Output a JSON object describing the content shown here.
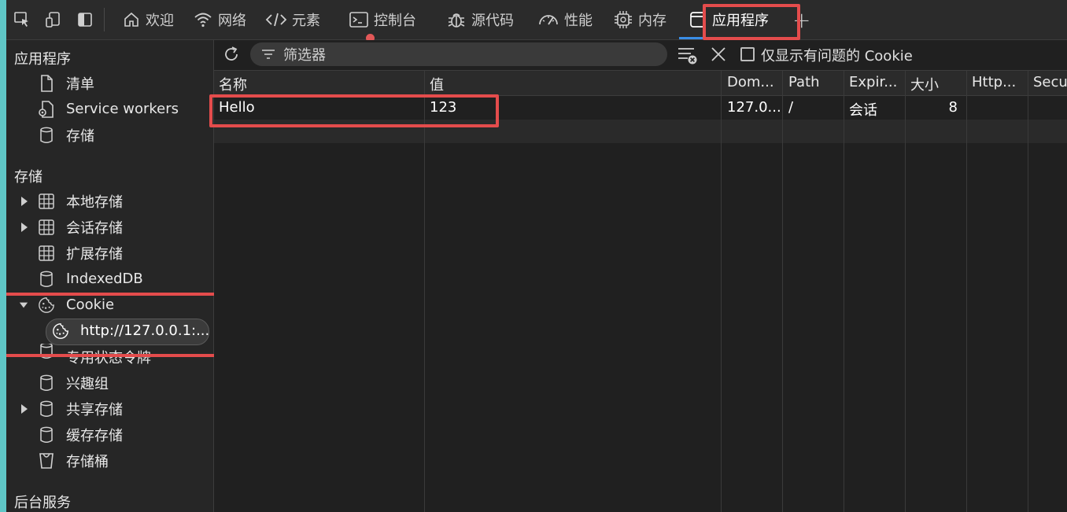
{
  "topbar": {
    "tabs": [
      {
        "label": "欢迎",
        "icon": "home-icon"
      },
      {
        "label": "网络",
        "icon": "wifi-icon"
      },
      {
        "label": "元素",
        "icon": "code-icon"
      },
      {
        "label": "控制台",
        "icon": "console-icon"
      },
      {
        "label": "源代码",
        "icon": "bug-icon"
      },
      {
        "label": "性能",
        "icon": "gauge-icon"
      },
      {
        "label": "内存",
        "icon": "chip-icon"
      },
      {
        "label": "应用程序",
        "icon": "window-icon"
      }
    ],
    "add_tab": "+"
  },
  "sidebar": {
    "section1": {
      "title": "应用程序",
      "items": [
        {
          "label": "清单",
          "icon": "document-icon"
        },
        {
          "label": "Service workers",
          "icon": "service-worker-icon"
        },
        {
          "label": "存储",
          "icon": "database-icon"
        }
      ]
    },
    "section2": {
      "title": "存储",
      "items": [
        {
          "label": "本地存储",
          "icon": "grid-icon"
        },
        {
          "label": "会话存储",
          "icon": "grid-icon"
        },
        {
          "label": "扩展存储",
          "icon": "grid-icon"
        },
        {
          "label": "IndexedDB",
          "icon": "database-icon"
        },
        {
          "label": "Cookie",
          "icon": "cookie-icon"
        },
        {
          "label": "http://127.0.0.1:...",
          "icon": "cookie-icon"
        },
        {
          "label": "专用状态令牌",
          "icon": "database-icon"
        },
        {
          "label": "兴趣组",
          "icon": "database-icon"
        },
        {
          "label": "共享存储",
          "icon": "database-icon"
        },
        {
          "label": "缓存存储",
          "icon": "database-icon"
        },
        {
          "label": "存储桶",
          "icon": "bucket-icon"
        }
      ]
    },
    "section3": {
      "title": "后台服务"
    }
  },
  "toolbar": {
    "filter_placeholder": "筛选器",
    "only_issues_label": "仅显示有问题的 Cookie",
    "only_issues_checked": false
  },
  "table": {
    "columns": [
      "名称",
      "值",
      "Dom...",
      "Path",
      "Expir...",
      "大小",
      "Http...",
      "Secur"
    ],
    "rows": [
      {
        "name": "Hello",
        "value": "123",
        "domain": "127.0...",
        "path": "/",
        "expires": "会话",
        "size": "8",
        "http": "",
        "secure": ""
      }
    ]
  },
  "colors": {
    "highlight": "#e44c4c",
    "active_tab_underline": "#3a8ee6",
    "background": "#202020"
  }
}
